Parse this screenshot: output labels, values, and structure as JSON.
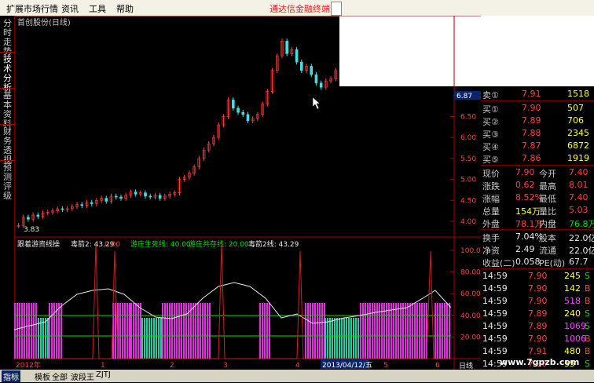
{
  "menu": {
    "items": [
      "扩展市场行情",
      "资讯",
      "工具",
      "帮助"
    ],
    "promo": "通达信金融终端"
  },
  "sidebar": {
    "tabs": [
      "分时走势",
      "技术分析",
      "基本资料",
      "财务透视",
      "预测评级"
    ]
  },
  "chart": {
    "title": "首创股份(日线)",
    "low_marker": "3.83",
    "price_axis": [
      "6.87",
      "6.50",
      "6.00",
      "5.50",
      "5.00",
      "4.50",
      "4.00"
    ],
    "current_price_tag": "6.87",
    "indicator_header": {
      "name": "跟着游资线操",
      "items": [
        {
          "label": "毒箭2: 43.29",
          "color": "#e8e8e8"
        },
        {
          "label": "0.00",
          "color": "#ff4040"
        },
        {
          "label": "游庄生死线: 40.00",
          "color": "#00e000"
        },
        {
          "label": "游庄共存线: 20.00",
          "color": "#00e000"
        },
        {
          "label": "毒箭2线: 43.29",
          "color": "#e8e8e8"
        }
      ]
    },
    "indicator_axis": [
      "100.0",
      "80.00",
      "60.00",
      "40.00",
      "20.00"
    ],
    "time_labels": [
      "2012年",
      "1",
      "2",
      "3",
      "4",
      "5",
      "6"
    ],
    "cursor_date": "2013/04/12/五",
    "period": "日线",
    "candles": [
      3.9,
      4.1,
      4.05,
      4.15,
      4.12,
      4.2,
      4.22,
      4.25,
      4.3,
      4.28,
      4.3,
      4.35,
      4.4,
      4.38,
      4.45,
      4.42,
      4.5,
      4.55,
      4.48,
      4.6,
      4.58,
      4.55,
      4.62,
      4.7,
      4.65,
      4.68,
      4.6,
      4.58,
      4.62,
      4.55,
      4.6,
      4.65,
      4.68,
      5.0,
      5.05,
      5.15,
      5.3,
      5.5,
      5.7,
      5.85,
      6.0,
      6.3,
      6.5,
      6.9,
      6.7,
      6.6,
      6.55,
      6.4,
      6.45,
      6.55,
      6.8,
      7.1,
      7.6,
      7.95,
      8.3,
      8.0,
      8.1,
      7.8,
      7.6,
      7.7,
      7.5,
      7.3,
      7.2,
      7.35,
      7.4,
      7.6
    ]
  },
  "quote": {
    "sells": [
      {
        "label": "卖①",
        "price": "7.91",
        "vol": "1518"
      }
    ],
    "buys": [
      {
        "label": "买①",
        "price": "7.90",
        "vol": "507"
      },
      {
        "label": "买②",
        "price": "7.89",
        "vol": "706"
      },
      {
        "label": "买③",
        "price": "7.88",
        "vol": "2345"
      },
      {
        "label": "买④",
        "price": "7.87",
        "vol": "6872"
      },
      {
        "label": "买⑤",
        "price": "7.86",
        "vol": "1919"
      }
    ],
    "stats": [
      {
        "l1": "现价",
        "v1": "7.90",
        "l2": "今开",
        "v2": "7.40"
      },
      {
        "l1": "涨跌",
        "v1": "0.62",
        "l2": "最高",
        "v2": "8.01"
      },
      {
        "l1": "涨幅",
        "v1": "8.52%",
        "l2": "最低",
        "v2": "7.40"
      },
      {
        "l1": "总量",
        "v1": "154万",
        "l2": "量比",
        "v2": "5.03"
      },
      {
        "l1": "外盘",
        "v1": "78.1万",
        "l2": "内盘",
        "v2": "76.8万"
      }
    ],
    "extra": [
      {
        "l1": "换手",
        "v1": "7.04%",
        "l2": "股本",
        "v2": "22.0亿"
      },
      {
        "l1": "净资",
        "v1": "2.49",
        "l2": "流通",
        "v2": "22.0亿"
      },
      {
        "l1": "收益(二)",
        "v1": "0.058",
        "l2": "PE(动)",
        "v2": "67.7"
      }
    ],
    "ticks": [
      {
        "time": "14:59",
        "price": "7.90",
        "vol": "245",
        "side": "S"
      },
      {
        "time": "14:59",
        "price": "7.90",
        "vol": "142",
        "side": "B"
      },
      {
        "time": "14:59",
        "price": "7.90",
        "vol": "518",
        "side": "B"
      },
      {
        "time": "14:59",
        "price": "7.89",
        "vol": "240",
        "side": "S"
      },
      {
        "time": "14:59",
        "price": "7.89",
        "vol": "1069",
        "side": "S"
      },
      {
        "time": "14:59",
        "price": "7.90",
        "vol": "1006",
        "side": "B"
      },
      {
        "time": "14:59",
        "price": "7.91",
        "vol": "480",
        "side": "B"
      },
      {
        "time": "14:59",
        "price": "7.90",
        "vol": "55",
        "side": "S"
      },
      {
        "time": "14:59",
        "price": "7.91",
        "vol": "49",
        "side": "B"
      }
    ]
  },
  "bottom_tabs": [
    "指标",
    "模板",
    "全部",
    "波段王",
    "ZJTJ"
  ],
  "watermark": "www.7gpzb.com"
}
